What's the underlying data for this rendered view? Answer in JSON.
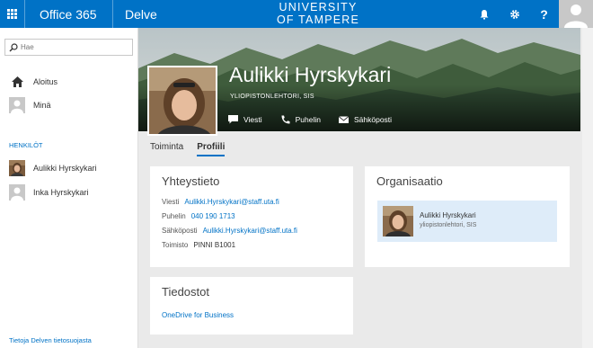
{
  "topbar": {
    "brand": "Office 365",
    "app": "Delve",
    "university_line1": "UNIVERSITY",
    "university_line2": "OF TAMPERE",
    "help_label": "?"
  },
  "leftnav": {
    "search_placeholder": "Hae",
    "items": [
      {
        "label": "Aloitus",
        "icon": "home-icon"
      },
      {
        "label": "Minä",
        "icon": "person-icon"
      }
    ],
    "people_header": "HENKILÖT",
    "people": [
      {
        "label": "Aulikki Hyrskykari",
        "icon": "avatar"
      },
      {
        "label": "Inka Hyrskykari",
        "icon": "person-icon"
      }
    ],
    "privacy_link": "Tietoja Delven tietosuojasta"
  },
  "profile": {
    "name": "Aulikki Hyrskykari",
    "title": "YLIOPISTONLEHTORI, SIS",
    "actions": [
      {
        "label": "Viesti",
        "icon": "chat-icon"
      },
      {
        "label": "Puhelin",
        "icon": "phone-icon"
      },
      {
        "label": "Sähköposti",
        "icon": "mail-icon"
      }
    ]
  },
  "tabs": [
    {
      "label": "Toiminta",
      "active": false
    },
    {
      "label": "Profiili",
      "active": true
    }
  ],
  "contact": {
    "title": "Yhteystieto",
    "rows": [
      {
        "key": "Viesti",
        "value": "Aulikki.Hyrskykari@staff.uta.fi",
        "link": true
      },
      {
        "key": "Puhelin",
        "value": "040 190 1713",
        "link": true
      },
      {
        "key": "Sähköposti",
        "value": "Aulikki.Hyrskykari@staff.uta.fi",
        "link": true
      },
      {
        "key": "Toimisto",
        "value": "PINNI B1001",
        "link": false
      }
    ]
  },
  "organisation": {
    "title": "Organisaatio",
    "person_name": "Aulikki Hyrskykari",
    "person_title": "yliopistonlehtori, SIS"
  },
  "files": {
    "title": "Tiedostot",
    "link": "OneDrive for Business"
  },
  "colors": {
    "accent": "#0072c6",
    "selected_bg": "#deecf9"
  }
}
